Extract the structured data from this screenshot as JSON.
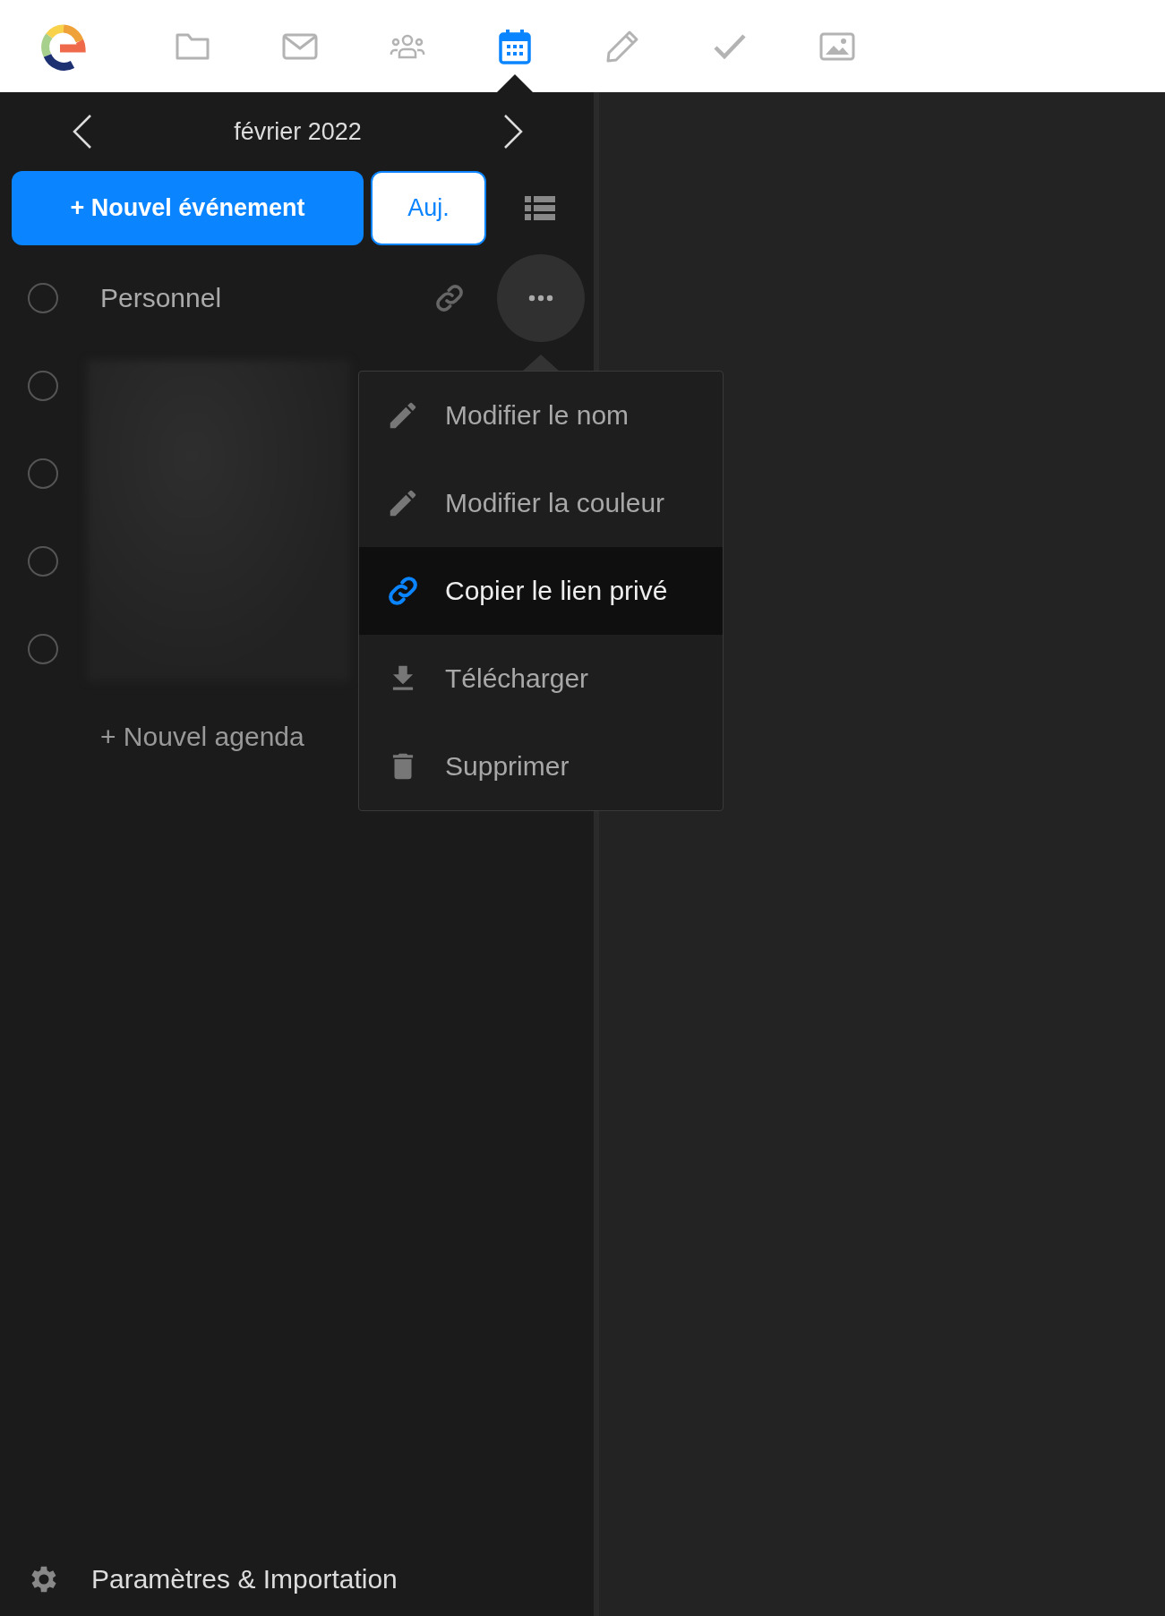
{
  "nav": [
    {
      "kind": "folder",
      "selected": false
    },
    {
      "kind": "mail",
      "selected": false
    },
    {
      "kind": "contacts",
      "selected": false
    },
    {
      "kind": "calendar",
      "selected": true
    },
    {
      "kind": "notes",
      "selected": false
    },
    {
      "kind": "tasks",
      "selected": false
    },
    {
      "kind": "photos",
      "selected": false
    }
  ],
  "sidebar": {
    "month": "février 2022",
    "new_event_button": "+ Nouvel événement",
    "today_button": "Auj.",
    "calendars": [
      {
        "name": "Personnel",
        "checked": false,
        "linked": true,
        "menu_open": true
      },
      {
        "checked": false,
        "linked": false,
        "menu_open": false
      },
      {
        "checked": false,
        "linked": false,
        "menu_open": false
      },
      {
        "checked": false,
        "linked": false,
        "menu_open": false
      },
      {
        "checked": false,
        "linked": false,
        "menu_open": false
      }
    ],
    "new_calendar": "+ Nouvel agenda",
    "settings": "Paramètres & Importation"
  },
  "menu": {
    "items": [
      {
        "kind": "pencil",
        "label": "Modifier le nom",
        "selected": false
      },
      {
        "kind": "pencil",
        "label": "Modifier la couleur",
        "selected": false
      },
      {
        "kind": "link",
        "label": "Copier le lien privé",
        "selected": true
      },
      {
        "kind": "download",
        "label": "Télécharger",
        "selected": false
      },
      {
        "kind": "trash",
        "label": "Supprimer",
        "selected": false
      }
    ]
  }
}
